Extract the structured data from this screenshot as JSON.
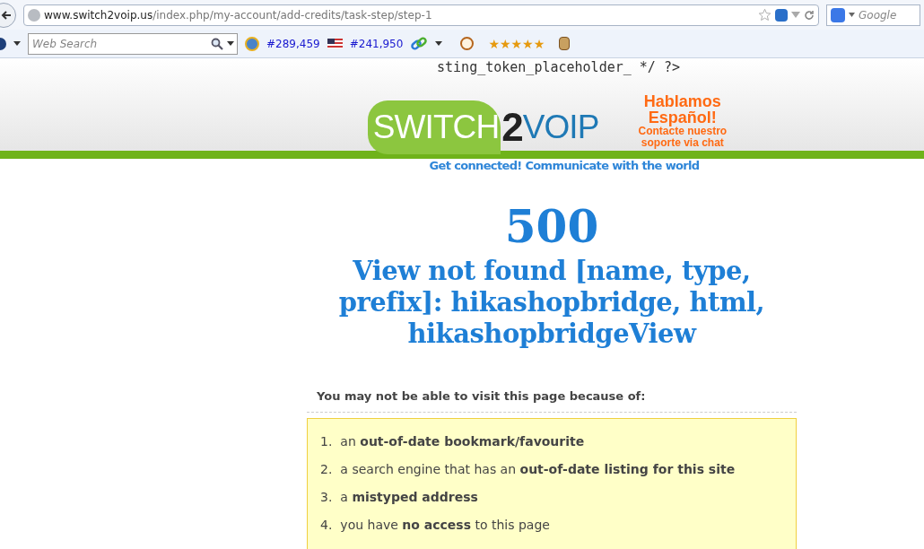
{
  "browser": {
    "url_host": "www.switch2voip.us",
    "url_path": "/index.php/my-account/add-credits/task-step/step-1",
    "search_engine_placeholder": "Google"
  },
  "toolbar": {
    "search_placeholder": "Web Search",
    "rank_global": "#289,459",
    "rank_country": "#241,950",
    "stars": 5
  },
  "header": {
    "code_text": "sting_token_placeholder_ */ ?>",
    "logo": {
      "part_1": "SWITCH",
      "part_2": "2",
      "part_3": "VOIP"
    },
    "promo": [
      "Hablamos",
      "Español!",
      "Contacte nuestro",
      "soporte via chat"
    ],
    "tagline": "Get connected!  Communicate with the world"
  },
  "error": {
    "code": "500",
    "message": "View not found [name, type, prefix]: hikashopbridge, html, hikashopbridgeView"
  },
  "reasons": {
    "intro": "You may not be able to visit this page because of:",
    "items": [
      {
        "number": "1.",
        "text": "an **out-of-date bookmark/favourite**"
      },
      {
        "number": "2.",
        "text": "a search engine that has an **out-of-date listing for this site**"
      },
      {
        "number": "3.",
        "text": "a **mistyped address**"
      },
      {
        "number": "4.",
        "text": "you have **no access** to this page"
      }
    ]
  }
}
